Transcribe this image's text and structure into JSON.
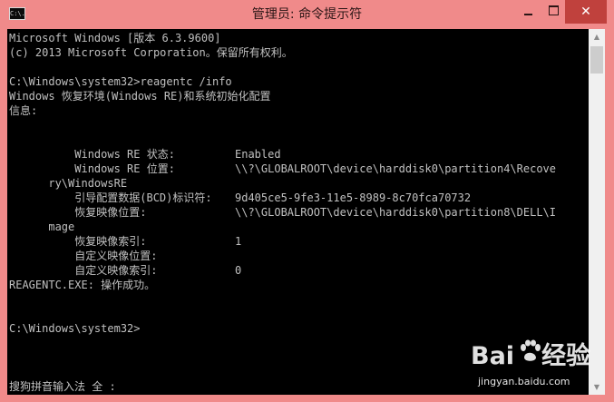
{
  "window": {
    "title": "管理员: 命令提示符",
    "icon_text": "C:\\.",
    "close_glyph": "✕"
  },
  "console": {
    "header1": "Microsoft Windows [版本 6.3.9600]",
    "header2": "(c) 2013 Microsoft Corporation。保留所有权利。",
    "command": "C:\\Windows\\system32>reagentc /info",
    "info_title": "Windows 恢复环境(Windows RE)和系统初始化配置",
    "info_label": "信息:",
    "rows": [
      {
        "label": "    Windows RE 状态:",
        "value": "Enabled"
      },
      {
        "label": "    Windows RE 位置:",
        "value": "\\\\?\\GLOBALROOT\\device\\harddisk0\\partition4\\Recove"
      },
      {
        "label": "ry\\WindowsRE",
        "value": ""
      },
      {
        "label": "    引导配置数据(BCD)标识符:",
        "value": "9d405ce5-9fe3-11e5-8989-8c70fca70732"
      },
      {
        "label": "    恢复映像位置:",
        "value": "\\\\?\\GLOBALROOT\\device\\harddisk0\\partition8\\DELL\\I"
      },
      {
        "label": "mage",
        "value": ""
      },
      {
        "label": "    恢复映像索引:",
        "value": "1"
      },
      {
        "label": "    自定义映像位置:",
        "value": ""
      },
      {
        "label": "    自定义映像索引:",
        "value": "0"
      }
    ],
    "result": "REAGENTC.EXE: 操作成功。",
    "prompt": "C:\\Windows\\system32>",
    "ime_status": "搜狗拼音输入法 全 :"
  },
  "watermark": {
    "logo_left": "Bai",
    "logo_right": "经验",
    "site": "jingyan.baidu.com"
  }
}
